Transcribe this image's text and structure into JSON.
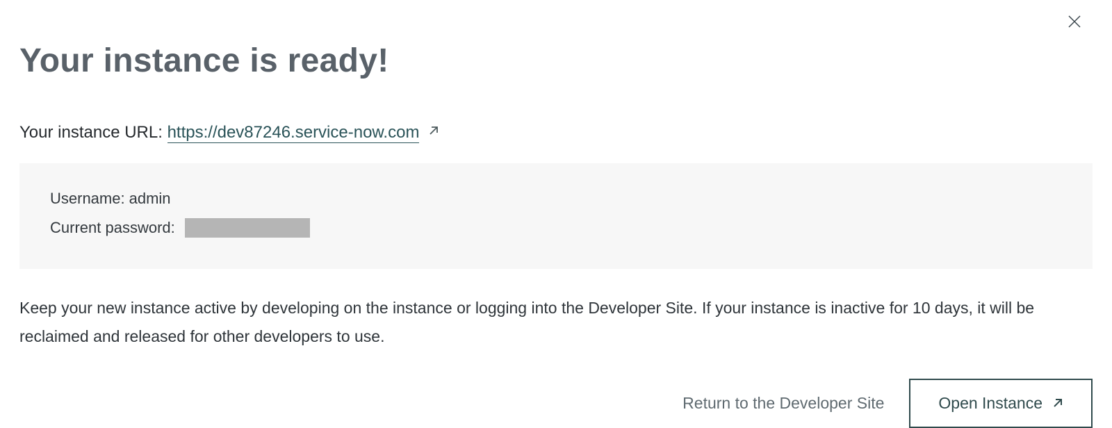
{
  "dialog": {
    "title": "Your instance is ready!",
    "url_label": "Your instance URL:",
    "url_value": "https://dev87246.service-now.com",
    "credentials": {
      "username_label": "Username:",
      "username_value": "admin",
      "password_label": "Current password:"
    },
    "notice": "Keep your new instance active by developing on the instance or logging into the Developer Site. If your instance is inactive for 10 days, it will be reclaimed and released for other developers to use.",
    "actions": {
      "return_label": "Return to the Developer Site",
      "open_label": "Open Instance"
    }
  }
}
